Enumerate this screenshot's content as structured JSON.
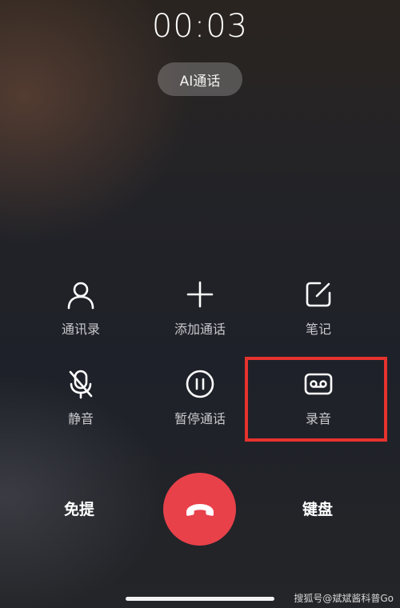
{
  "call": {
    "timer": "00:03",
    "ai_call_label": "AI通话"
  },
  "controls": [
    {
      "label": "通讯录",
      "icon": "contacts-icon"
    },
    {
      "label": "添加通话",
      "icon": "plus-icon"
    },
    {
      "label": "笔记",
      "icon": "note-edit-icon"
    },
    {
      "label": "静音",
      "icon": "mic-off-icon"
    },
    {
      "label": "暂停通话",
      "icon": "pause-icon"
    },
    {
      "label": "录音",
      "icon": "voicemail-record-icon"
    }
  ],
  "bottom": {
    "speaker_label": "免提",
    "keypad_label": "键盘",
    "hangup_icon": "phone-hangup-icon"
  },
  "watermark": "搜狐号@斌斌酱科普Go",
  "colors": {
    "hangup": "#e8414a",
    "highlight_border": "#e6322e"
  }
}
